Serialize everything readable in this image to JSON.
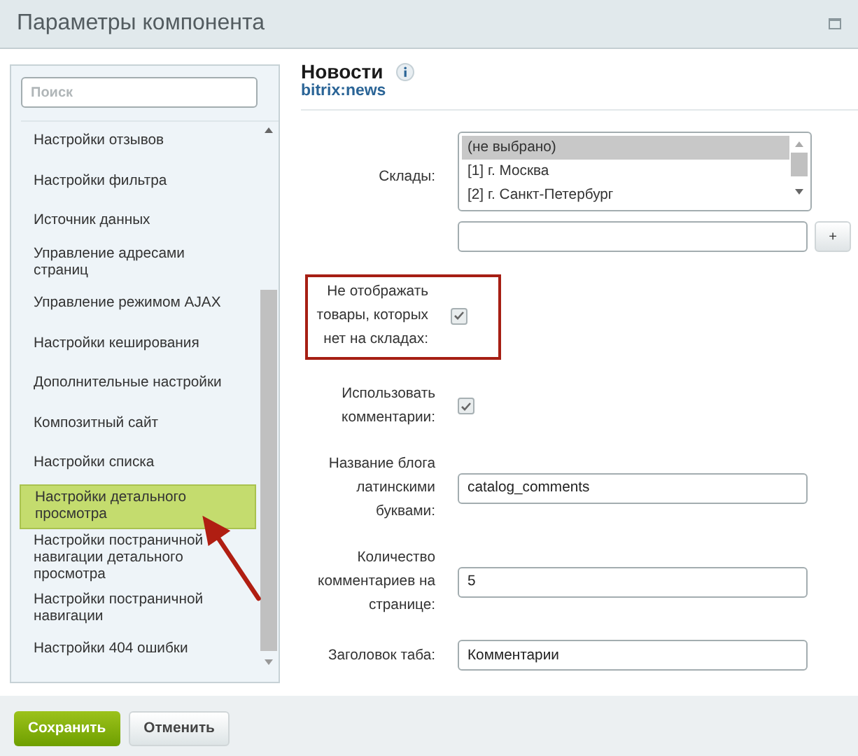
{
  "window": {
    "title": "Параметры компонента"
  },
  "sidebar": {
    "search": {
      "placeholder": "Поиск"
    },
    "items": [
      {
        "label": "Настройки отзывов",
        "selected": false
      },
      {
        "label": "Настройки фильтра",
        "selected": false
      },
      {
        "label": "Источник данных",
        "selected": false
      },
      {
        "label": "Управление адресами страниц",
        "selected": false
      },
      {
        "label": "Управление режимом AJAX",
        "selected": false
      },
      {
        "label": "Настройки кеширования",
        "selected": false
      },
      {
        "label": "Дополнительные настройки",
        "selected": false
      },
      {
        "label": "Композитный сайт",
        "selected": false
      },
      {
        "label": "Настройки списка",
        "selected": false
      },
      {
        "label": "Настройки детального просмотра",
        "selected": true,
        "arrow": true
      },
      {
        "label": "Настройки постраничной навигации детального просмотра",
        "selected": false
      },
      {
        "label": "Настройки постраничной навигации",
        "selected": false
      },
      {
        "label": "Настройки 404 ошибки",
        "selected": false
      }
    ]
  },
  "component": {
    "title": "Новости",
    "code": "bitrix:news"
  },
  "fields": [
    {
      "kind": "multiselect",
      "label": "Склады:",
      "options": [
        {
          "label": "(не выбрано)",
          "selected": true
        },
        {
          "label": "[1] г. Москва",
          "selected": false
        },
        {
          "label": "[2] г. Санкт-Петербург",
          "selected": false
        }
      ],
      "add_button": "+"
    },
    {
      "kind": "checkbox",
      "label": "Не отображать товары, которых нет на складах:",
      "checked": true,
      "highlighted": true
    },
    {
      "kind": "checkbox",
      "label": "Использовать комментарии:",
      "checked": true,
      "highlighted": false
    },
    {
      "kind": "text",
      "label": "Название блога латинскими буквами:",
      "value": "catalog_comments"
    },
    {
      "kind": "text",
      "label": "Количество комментариев на странице:",
      "value": "5"
    },
    {
      "kind": "text",
      "label": "Заголовок таба:",
      "value": "Комментарии"
    }
  ],
  "buttons": [
    {
      "label": "Сохранить",
      "kind": "primary"
    },
    {
      "label": "Отменить",
      "kind": "secondary"
    }
  ]
}
